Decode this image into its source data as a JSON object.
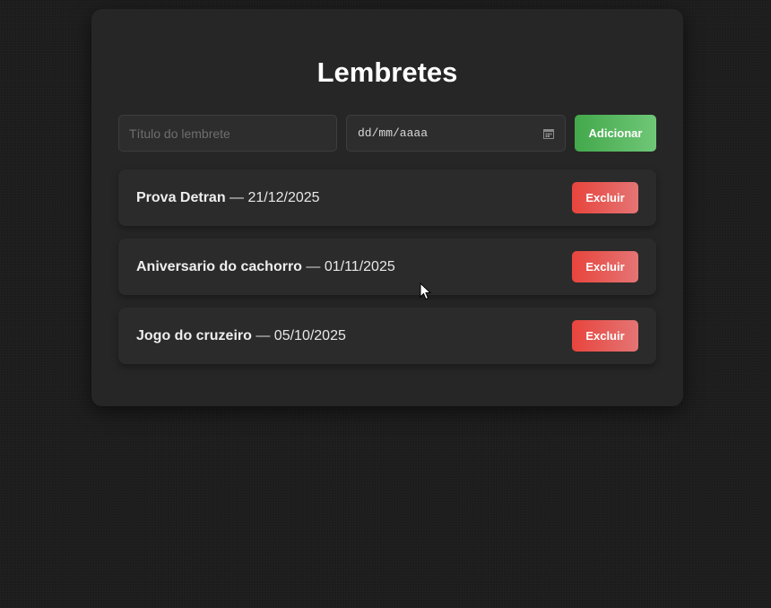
{
  "header": {
    "title": "Lembretes"
  },
  "form": {
    "title_placeholder": "Título do lembrete",
    "date_placeholder": "dd/mm/aaaa",
    "add_label": "Adicionar"
  },
  "reminders": [
    {
      "title": "Prova Detran",
      "separator": " — ",
      "date": "21/12/2025",
      "delete_label": "Excluir"
    },
    {
      "title": "Aniversario do cachorro",
      "separator": " — ",
      "date": "01/11/2025",
      "delete_label": "Excluir"
    },
    {
      "title": "Jogo do cruzeiro",
      "separator": " — ",
      "date": "05/10/2025",
      "delete_label": "Excluir"
    }
  ],
  "colors": {
    "add_button": "#4caf50",
    "delete_button": "#e53935",
    "card_bg": "#262626",
    "page_bg": "#1c1c1c"
  },
  "icons": {
    "date_picker": "calendar-icon",
    "pointer": "mouse-cursor-icon"
  }
}
